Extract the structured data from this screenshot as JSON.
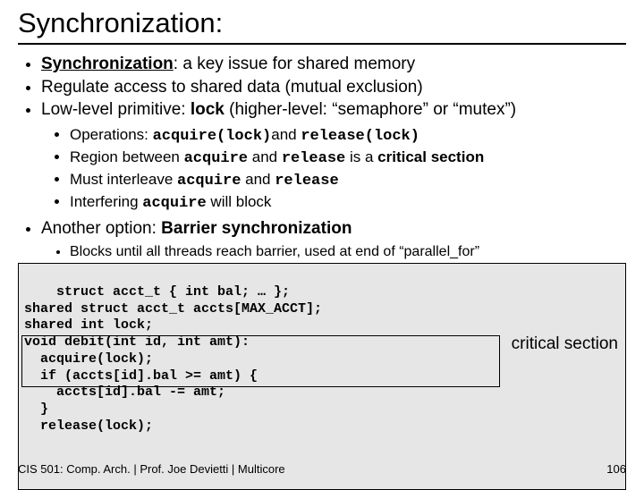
{
  "title": "Synchronization:",
  "bullets": {
    "b1_pre": "Synchronization",
    "b1_post": ": a key issue for shared memory",
    "b2": "Regulate access to shared data (mutual exclusion)",
    "b3_pre": "Low-level primitive: ",
    "b3_lock": "lock",
    "b3_post": "  (higher-level: “semaphore” or “mutex”)",
    "s1_a": "Operations: ",
    "s1_b": "acquire(lock)",
    "s1_c": "and ",
    "s1_d": "release(lock)",
    "s2_a": "Region between ",
    "s2_b": "acquire",
    "s2_c": " and ",
    "s2_d": "release",
    "s2_e": " is a ",
    "s2_f": "critical section",
    "s3_a": "Must interleave ",
    "s3_b": "acquire",
    "s3_c": " and ",
    "s3_d": "release",
    "s4_a": "Interfering ",
    "s4_b": "acquire",
    "s4_c": " will block",
    "b4_a": "Another option: ",
    "b4_b": "Barrier synchronization",
    "s5": "Blocks until all threads reach barrier, used at end of “parallel_for”"
  },
  "code": "struct acct_t { int bal; … };\nshared struct acct_t accts[MAX_ACCT];\nshared int lock;\nvoid debit(int id, int amt):\n  acquire(lock);\n  if (accts[id].bal >= amt) {\n    accts[id].bal -= amt;\n  }\n  release(lock);",
  "critlabel": "critical section",
  "footer_left": "CIS 501: Comp. Arch.  |  Prof. Joe Devietti  |  Multicore",
  "footer_right": "106"
}
